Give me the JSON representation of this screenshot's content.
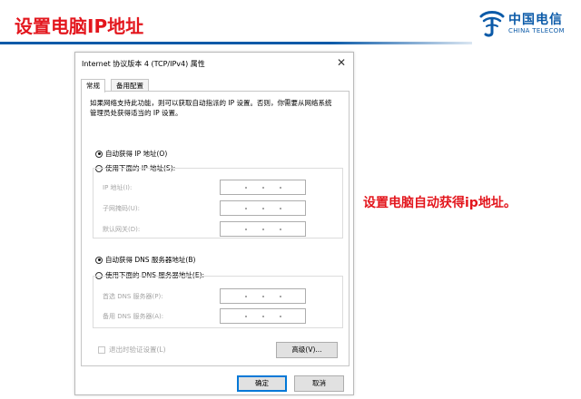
{
  "slide": {
    "title": "设置电脑IP地址",
    "note": "设置电脑自动获得ip地址。",
    "colors": {
      "title_red": "#e3161d",
      "brand_blue": "#0b5aa8"
    }
  },
  "logo": {
    "icon": "china-telecom-logo-icon",
    "name_cn": "中国电信",
    "name_en": "CHINA TELECOM"
  },
  "dialog": {
    "title": "Internet 协议版本 4 (TCP/IPv4) 属性",
    "close_icon": "close-icon",
    "tabs": [
      {
        "label": "常规",
        "active": true
      },
      {
        "label": "备用配置",
        "active": false
      }
    ],
    "description": "如果网络支持此功能，则可以获取自动指派的 IP 设置。否则，你需要从网络系统管理员处获得适当的 IP 设置。",
    "ip_auto": {
      "label": "自动获得 IP 地址(O)",
      "selected": true
    },
    "ip_manual": {
      "label": "使用下面的 IP 地址(S):",
      "selected": false
    },
    "ip_fields": [
      {
        "label": "IP 地址(I):"
      },
      {
        "label": "子网掩码(U):"
      },
      {
        "label": "默认网关(D):"
      }
    ],
    "dns_auto": {
      "label": "自动获得 DNS 服务器地址(B)",
      "selected": true
    },
    "dns_manual": {
      "label": "使用下面的 DNS 服务器地址(E):",
      "selected": false
    },
    "dns_fields": [
      {
        "label": "首选 DNS 服务器(P):"
      },
      {
        "label": "备用 DNS 服务器(A):"
      }
    ],
    "validate_checkbox": {
      "label": "退出时验证设置(L)",
      "checked": false
    },
    "advanced_button": "高级(V)...",
    "ok_button": "确定",
    "cancel_button": "取消"
  }
}
